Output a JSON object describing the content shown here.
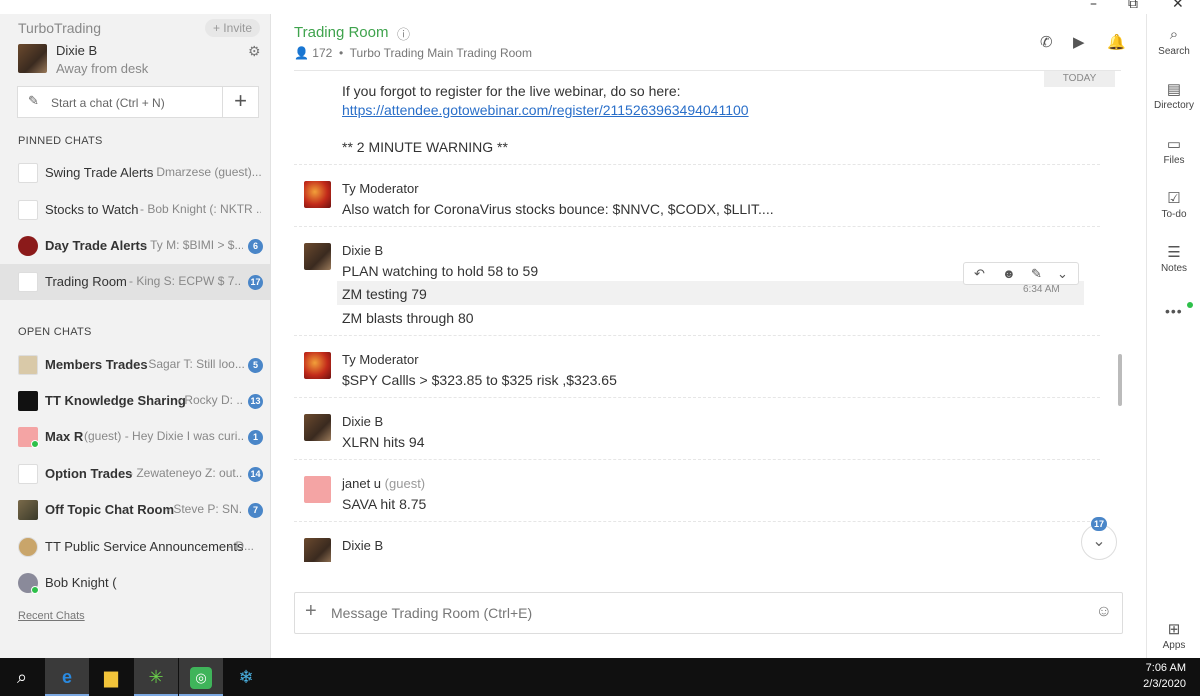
{
  "window": {
    "minimize": "–",
    "restore": "⧉",
    "close": "✕"
  },
  "sidebar": {
    "brand": "TurboTrading",
    "invite": "+ Invite",
    "user": {
      "name": "Dixie B",
      "status": "Away from desk"
    },
    "new_chat_placeholder": "Start a chat (Ctrl + N)",
    "pinned_label": "PINNED CHATS",
    "pinned": [
      {
        "name": "Swing Trade Alerts",
        "preview": "- Dmarzese (guest)...",
        "badge": "",
        "icon": "turbo-logo-icon"
      },
      {
        "name": "Stocks to Watch",
        "preview": "- Bob Knight (: NKTR ...",
        "badge": "",
        "icon": "turbo-logo-icon"
      },
      {
        "name": "Day Trade Alerts",
        "preview": "- Ty M: $BIMI > $...",
        "badge": "6",
        "icon": "alert-logo-icon"
      },
      {
        "name": "Trading Room",
        "preview": "- King S: ECPW $ 7....",
        "badge": "17",
        "icon": "turbo-logo-icon"
      }
    ],
    "open_label": "OPEN CHATS",
    "open": [
      {
        "name": "Members Trades",
        "preview": "- Sagar T: Still loo...",
        "badge": "5",
        "icon": "heart-logo-icon"
      },
      {
        "name": "TT Knowledge Sharing",
        "preview": "- Rocky D: ...",
        "badge": "13",
        "icon": "knowledge-logo-icon"
      },
      {
        "name": "Max R",
        "guest": "(guest)",
        "preview": "- Hey Dixie I was curi...",
        "badge": "1",
        "icon": "guest-avatar-icon"
      },
      {
        "name": "Option Trades",
        "preview": "- Zewateneyo Z: out...",
        "badge": "14",
        "icon": "turbo-logo-icon"
      },
      {
        "name": "Off Topic Chat Room",
        "preview": "- Steve P: SN...",
        "badge": "7",
        "icon": "photo-avatar-icon"
      },
      {
        "name": "TT Public Service Announcements",
        "preview": "- D...",
        "badge": "",
        "icon": "seal-logo-icon"
      },
      {
        "name": "Bob Knight (",
        "preview": "",
        "badge": "",
        "icon": "user-avatar-icon"
      }
    ],
    "recent_chats": "Recent Chats"
  },
  "header": {
    "title": "Trading Room",
    "info_icon": "ⓘ",
    "member_count": "172",
    "description": "Turbo Trading Main Trading Room"
  },
  "messages": {
    "date_label": "TODAY",
    "m0_line1": "If you forgot to register for the live webinar, do so here:",
    "m0_link": "https://attendee.gotowebinar.com/register/2115263963494041100",
    "m0_line3": "** 2 MINUTE WARNING **",
    "m1_author": "Ty Moderator",
    "m1_text": "Also watch for CoronaVirus stocks bounce: $NNVC, $CODX, $LLIT....",
    "m2_author": "Dixie B",
    "m2_text1": "PLAN watching to hold 58 to 59",
    "m2_text2": "ZM testing 79",
    "m2_time": "6:34 AM",
    "m2_text3": "ZM blasts through 80",
    "m3_author": "Ty Moderator",
    "m3_text": "$SPY Callls >  $323.85 to $325 risk ,$323.65",
    "m4_author": "Dixie B",
    "m4_text": "XLRN hits 94",
    "m5_author": "janet u",
    "m5_guest": "(guest)",
    "m5_text": "SAVA hit 8.75",
    "m6_author": "Dixie B",
    "unread_count": "17"
  },
  "composer": {
    "placeholder": "Message Trading Room (Ctrl+E)"
  },
  "rail": {
    "items": [
      {
        "label": "Search",
        "icon": "search-icon"
      },
      {
        "label": "Directory",
        "icon": "directory-icon"
      },
      {
        "label": "Files",
        "icon": "files-icon"
      },
      {
        "label": "To-do",
        "icon": "todo-icon"
      },
      {
        "label": "Notes",
        "icon": "notes-icon"
      }
    ],
    "apps": "Apps"
  },
  "taskbar": {
    "time": "7:06 AM",
    "date": "2/3/2020"
  }
}
